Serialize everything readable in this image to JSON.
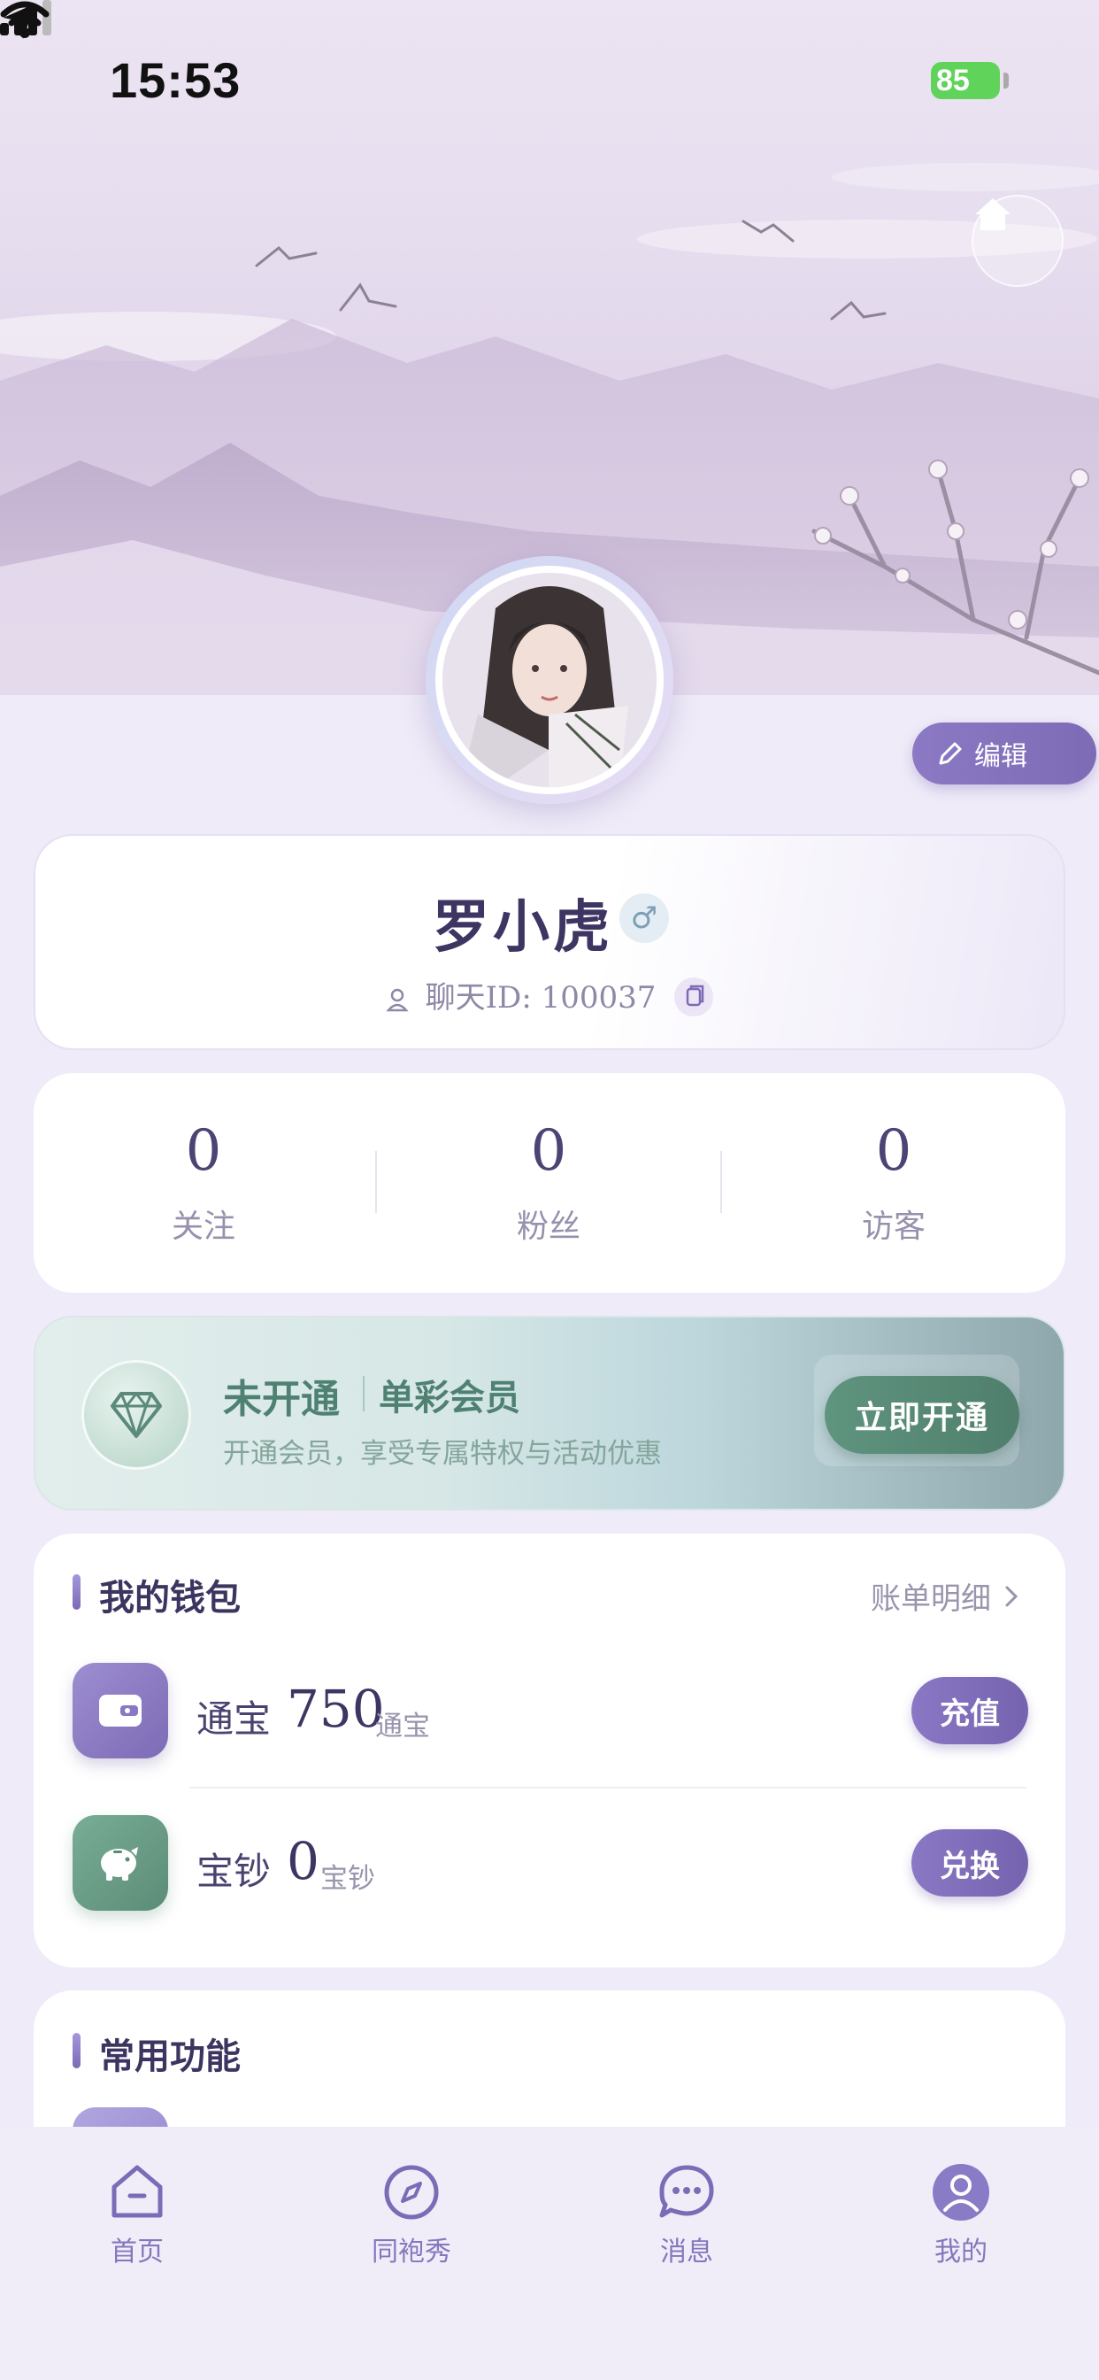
{
  "status_bar": {
    "time": "15:53",
    "battery": "85"
  },
  "profile": {
    "name": "罗小虎",
    "gender_symbol": "♂",
    "chat_id_label": "聊天ID: 100037",
    "edit_label": "编辑"
  },
  "stats": [
    {
      "value": "0",
      "label": "关注"
    },
    {
      "value": "0",
      "label": "粉丝"
    },
    {
      "value": "0",
      "label": "访客"
    }
  ],
  "vip": {
    "status": "未开通",
    "name": "单彩会员",
    "description": "开通会员，享受专属特权与活动优惠",
    "button": "立即开通"
  },
  "wallet": {
    "title": "我的钱包",
    "bill_link": "账单明细",
    "items": [
      {
        "label": "通宝",
        "amount": "750",
        "unit": "通宝",
        "button": "充值",
        "icon": "wallet-icon"
      },
      {
        "label": "宝钞",
        "amount": "0",
        "unit": "宝钞",
        "button": "兑换",
        "icon": "piggy-bank-icon"
      }
    ]
  },
  "functions": {
    "title": "常用功能"
  },
  "tabbar": [
    {
      "label": "首页",
      "icon": "home-icon"
    },
    {
      "label": "同袍秀",
      "icon": "compass-icon"
    },
    {
      "label": "消息",
      "icon": "chat-bubble-icon"
    },
    {
      "label": "我的",
      "icon": "user-icon"
    }
  ],
  "colors": {
    "accent": "#7d6bb6",
    "vip_green": "#4f8172",
    "background": "#efebf8"
  }
}
